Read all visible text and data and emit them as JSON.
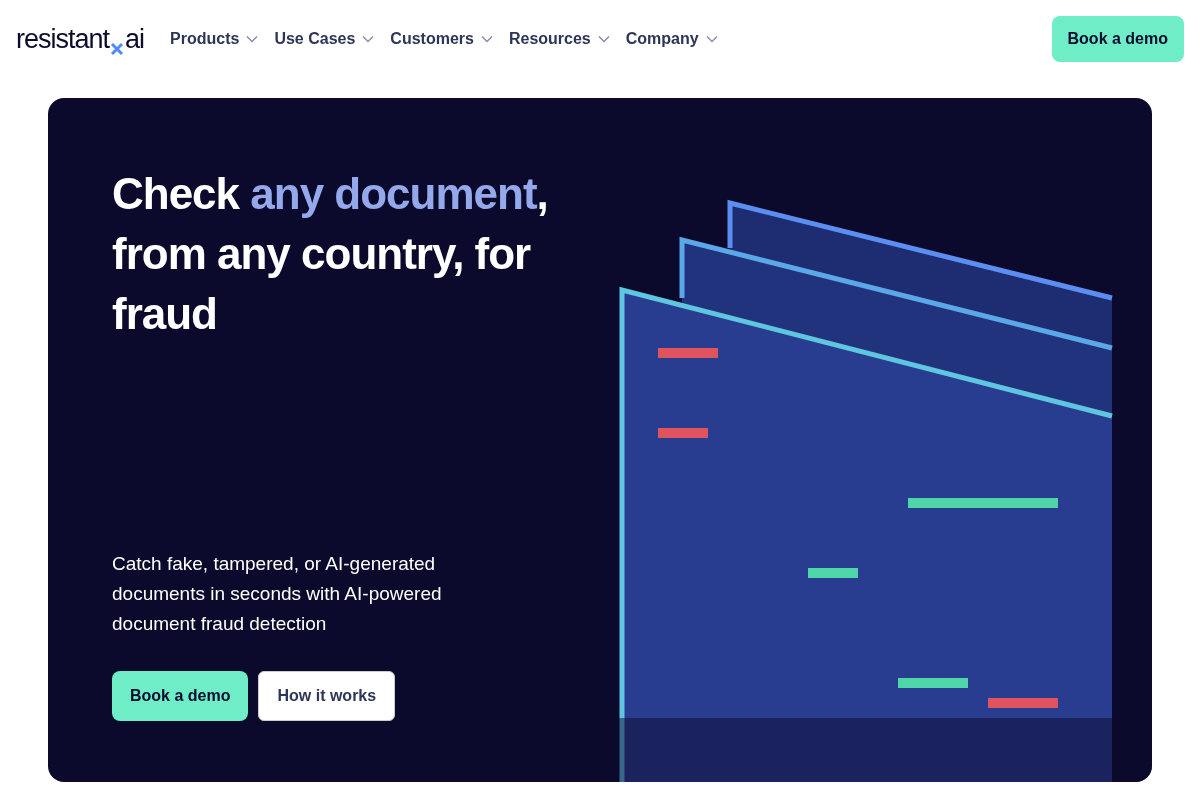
{
  "logo": {
    "left": "resistant",
    "right": "ai"
  },
  "nav": [
    {
      "label": "Products"
    },
    {
      "label": "Use Cases"
    },
    {
      "label": "Customers"
    },
    {
      "label": "Resources"
    },
    {
      "label": "Company"
    }
  ],
  "header_button": "Book a demo",
  "hero": {
    "headline": {
      "before": "Check ",
      "highlighted": "any document",
      "after": ", from any country, for fraud"
    },
    "subtitle": "Catch fake, tampered, or AI-generated documents in seconds with AI-powered document fraud detection",
    "buttons": [
      {
        "label": "Book a demo",
        "kind": "primary"
      },
      {
        "label": "How it works",
        "kind": "secondary"
      }
    ]
  }
}
